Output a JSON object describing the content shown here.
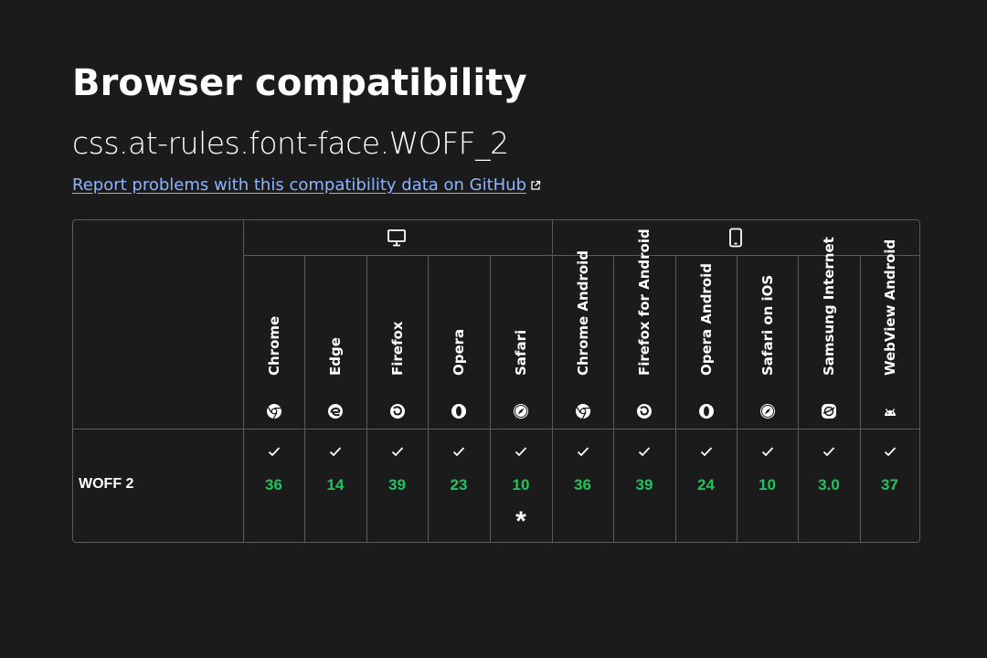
{
  "title": "Browser compatibility",
  "subtitle": "css.at-rules.font-face.WOFF_2",
  "report_link": "Report problems with this compatibility data on GitHub",
  "groups": [
    {
      "name": "desktop",
      "icon": "desktop-icon"
    },
    {
      "name": "mobile",
      "icon": "mobile-icon"
    }
  ],
  "browsers": [
    {
      "name": "Chrome",
      "icon": "chrome-icon"
    },
    {
      "name": "Edge",
      "icon": "edge-icon"
    },
    {
      "name": "Firefox",
      "icon": "firefox-icon"
    },
    {
      "name": "Opera",
      "icon": "opera-icon"
    },
    {
      "name": "Safari",
      "icon": "safari-icon"
    },
    {
      "name": "Chrome Android",
      "icon": "chrome-icon"
    },
    {
      "name": "Firefox for Android",
      "icon": "firefox-icon"
    },
    {
      "name": "Opera Android",
      "icon": "opera-icon"
    },
    {
      "name": "Safari on iOS",
      "icon": "safari-icon"
    },
    {
      "name": "Samsung Internet",
      "icon": "samsung-internet-icon"
    },
    {
      "name": "WebView Android",
      "icon": "android-icon"
    }
  ],
  "row": {
    "label": "WOFF 2",
    "support": [
      {
        "version": "36",
        "note": ""
      },
      {
        "version": "14",
        "note": ""
      },
      {
        "version": "39",
        "note": ""
      },
      {
        "version": "23",
        "note": ""
      },
      {
        "version": "10",
        "note": "*"
      },
      {
        "version": "36",
        "note": ""
      },
      {
        "version": "39",
        "note": ""
      },
      {
        "version": "24",
        "note": ""
      },
      {
        "version": "10",
        "note": ""
      },
      {
        "version": "3.0",
        "note": ""
      },
      {
        "version": "37",
        "note": ""
      }
    ]
  },
  "colors": {
    "background": "#1b1b1b",
    "link": "#8cb4ff",
    "supported": "#1fc45c",
    "border": "#5a5a5a"
  }
}
